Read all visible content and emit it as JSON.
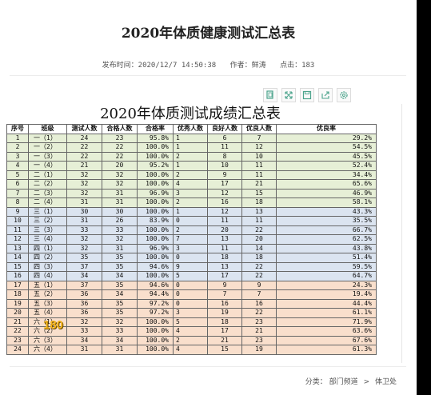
{
  "article": {
    "title": "2020年体质健康测试汇总表",
    "publish_time": "发布时间：2020/12/7 14:50:38",
    "author": "作者：鲜涛",
    "clicks": "点击：183"
  },
  "toolbar": {
    "icons": [
      "copy-icon",
      "fullscreen-icon",
      "save-icon",
      "share-icon",
      "settings-icon"
    ]
  },
  "sheet": {
    "title": "2020年体质测试成绩汇总表",
    "headers": [
      "序号",
      "班级",
      "测试人数",
      "合格人数",
      "合格率",
      "优秀人数",
      "良好人数",
      "优良人数",
      "优良率"
    ],
    "rows": [
      [
        "1",
        "一（1）",
        "24",
        "23",
        "95.8%",
        "1",
        "6",
        "7",
        "29.2%"
      ],
      [
        "2",
        "一（2）",
        "22",
        "22",
        "100.0%",
        "1",
        "11",
        "12",
        "54.5%"
      ],
      [
        "3",
        "一（3）",
        "22",
        "22",
        "100.0%",
        "2",
        "8",
        "10",
        "45.5%"
      ],
      [
        "4",
        "一（4）",
        "21",
        "20",
        "95.2%",
        "1",
        "10",
        "11",
        "52.4%"
      ],
      [
        "5",
        "二（1）",
        "32",
        "32",
        "100.0%",
        "2",
        "9",
        "11",
        "34.4%"
      ],
      [
        "6",
        "二（2）",
        "32",
        "32",
        "100.0%",
        "4",
        "17",
        "21",
        "65.6%"
      ],
      [
        "7",
        "二（3）",
        "32",
        "31",
        "96.9%",
        "3",
        "12",
        "15",
        "46.9%"
      ],
      [
        "8",
        "二（4）",
        "31",
        "31",
        "100.0%",
        "2",
        "16",
        "18",
        "58.1%"
      ],
      [
        "9",
        "三（1）",
        "30",
        "30",
        "100.0%",
        "1",
        "12",
        "13",
        "43.3%"
      ],
      [
        "10",
        "三（2）",
        "31",
        "26",
        "83.9%",
        "0",
        "11",
        "11",
        "35.5%"
      ],
      [
        "11",
        "三（3）",
        "33",
        "33",
        "100.0%",
        "2",
        "20",
        "22",
        "66.7%"
      ],
      [
        "12",
        "三（4）",
        "32",
        "32",
        "100.0%",
        "7",
        "13",
        "20",
        "62.5%"
      ],
      [
        "13",
        "四（1）",
        "32",
        "31",
        "96.9%",
        "3",
        "11",
        "14",
        "43.8%"
      ],
      [
        "14",
        "四（2）",
        "35",
        "35",
        "100.0%",
        "0",
        "18",
        "18",
        "51.4%"
      ],
      [
        "15",
        "四（3）",
        "37",
        "35",
        "94.6%",
        "9",
        "13",
        "22",
        "59.5%"
      ],
      [
        "16",
        "四（4）",
        "34",
        "34",
        "100.0%",
        "5",
        "17",
        "22",
        "64.7%"
      ],
      [
        "17",
        "五（1）",
        "37",
        "35",
        "94.6%",
        "0",
        "9",
        "9",
        "24.3%"
      ],
      [
        "18",
        "五（2）",
        "36",
        "34",
        "94.4%",
        "0",
        "7",
        "7",
        "19.4%"
      ],
      [
        "19",
        "五（3）",
        "36",
        "35",
        "97.2%",
        "0",
        "16",
        "16",
        "44.4%"
      ],
      [
        "20",
        "五（4）",
        "36",
        "35",
        "97.2%",
        "3",
        "19",
        "22",
        "61.1%"
      ],
      [
        "21",
        "六（1）",
        "32",
        "32",
        "100.0%",
        "5",
        "18",
        "23",
        "71.9%"
      ],
      [
        "22",
        "六（2）",
        "33",
        "33",
        "100.0%",
        "4",
        "17",
        "21",
        "63.6%"
      ],
      [
        "23",
        "六（3）",
        "34",
        "34",
        "100.0%",
        "2",
        "21",
        "23",
        "67.6%"
      ],
      [
        "24",
        "六（4）",
        "31",
        "31",
        "100.0%",
        "4",
        "15",
        "19",
        "61.3%"
      ]
    ]
  },
  "overlay_badge": "180",
  "footer": {
    "category_label": "分类：",
    "category": "部门频道",
    "separator": ">",
    "subcategory": "体卫处"
  },
  "colors": {
    "grade_1_2": "#e6efd6",
    "grade_3_4": "#dbe4f0",
    "grade_5_6": "#f9dfcc",
    "toolbar_icon": "#4aa38b",
    "badge": "#f4b41a"
  }
}
